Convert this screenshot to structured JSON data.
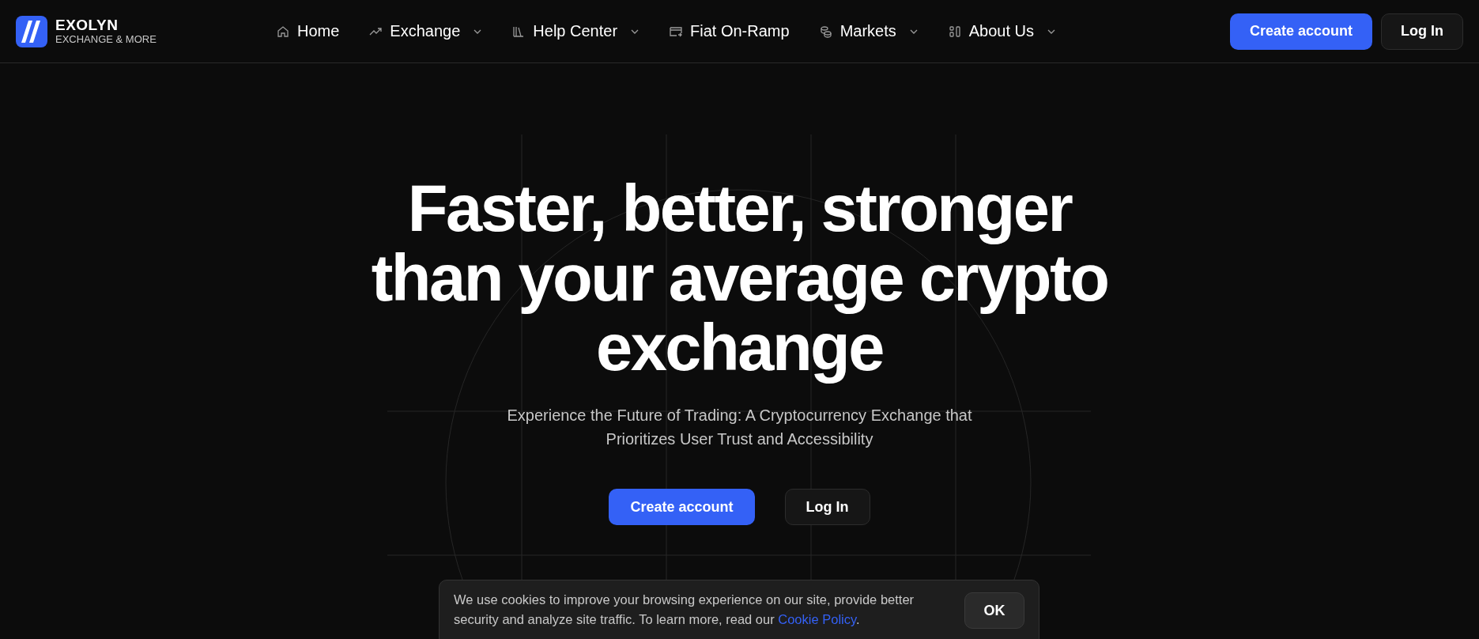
{
  "logo": {
    "name": "EXOLYN",
    "tagline": "EXCHANGE & MORE"
  },
  "nav": [
    {
      "label": "Home",
      "has_menu": false
    },
    {
      "label": "Exchange",
      "has_menu": true
    },
    {
      "label": "Help Center",
      "has_menu": true
    },
    {
      "label": "Fiat On-Ramp",
      "has_menu": false
    },
    {
      "label": "Markets",
      "has_menu": true
    },
    {
      "label": "About Us",
      "has_menu": true
    }
  ],
  "header_buttons": [
    {
      "label": "Create account",
      "kind": "primary"
    },
    {
      "label": "Log In",
      "kind": "secondary"
    }
  ],
  "hero": {
    "title": "Faster, better, stronger than your average crypto exchange",
    "subtitle": "Experience the Future of Trading: A Cryptocurrency Exchange that Prioritizes User Trust and Accessibility",
    "buttons": [
      {
        "label": "Create account",
        "kind": "primary"
      },
      {
        "label": "Log In",
        "kind": "secondary"
      }
    ]
  },
  "cookie_banner": {
    "text": "We use cookies to improve your browsing experience on our site, provide better security and analyze site traffic. To learn more, read our",
    "link": "Cookie Policy",
    "after": ".",
    "button": "OK"
  }
}
